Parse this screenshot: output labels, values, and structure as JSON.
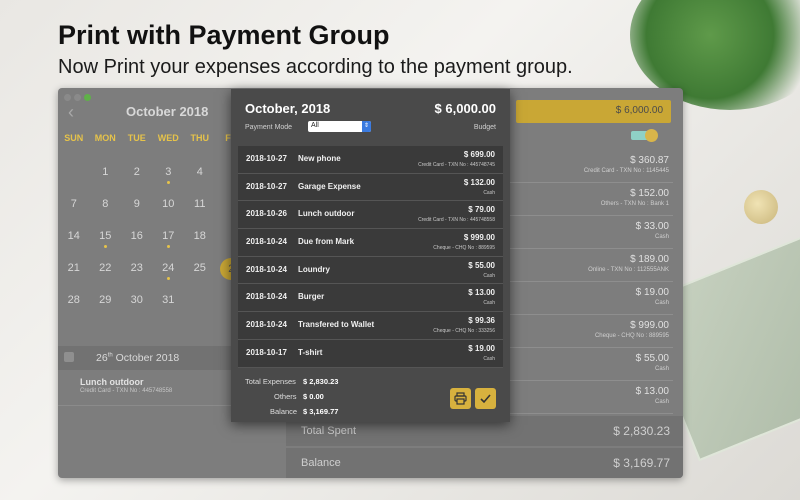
{
  "headline": "Print with Payment Group",
  "subline": "Now Print your expenses according to the payment group.",
  "calendar": {
    "back": "‹",
    "title": "October 2018",
    "days": [
      "SUN",
      "MON",
      "TUE",
      "WED",
      "THU",
      "FR"
    ],
    "rows": [
      [
        "",
        "1",
        "2",
        "3",
        "4",
        ""
      ],
      [
        "7",
        "8",
        "9",
        "10",
        "11",
        ""
      ],
      [
        "14",
        "15",
        "16",
        "17",
        "18",
        ""
      ],
      [
        "21",
        "22",
        "23",
        "24",
        "25",
        "2"
      ],
      [
        "28",
        "29",
        "30",
        "31",
        "",
        ""
      ]
    ]
  },
  "selected_date": {
    "day": "26",
    "suffix": "th",
    "rest": "October 2018"
  },
  "day_item": {
    "title": "Lunch outdoor",
    "sub": "Credit Card - TXN No : 445748558"
  },
  "budget_amount": "$ 6,000.00",
  "expenses": [
    {
      "amount": "$ 360.87",
      "sub": "Credit Card - TXN No : 1145445"
    },
    {
      "amount": "$ 152.00",
      "sub": "Others - TXN No : Bank 1"
    },
    {
      "amount": "$ 33.00",
      "sub": "Cash"
    },
    {
      "amount": "$ 189.00",
      "sub": "Online - TXN No : 112555ANK"
    },
    {
      "amount": "$ 19.00",
      "sub": "Cash"
    },
    {
      "amount": "$ 999.00",
      "sub": "Cheque - CHQ No : 889595"
    },
    {
      "amount": "$ 55.00",
      "sub": "Cash"
    },
    {
      "amount": "$ 13.00",
      "sub": "Cash"
    }
  ],
  "summary": {
    "total_spent_label": "Total Spent",
    "total_spent": "$ 2,830.23",
    "balance_label": "Balance",
    "balance": "$ 3,169.77"
  },
  "popup": {
    "month": "October, 2018",
    "total": "$ 6,000.00",
    "mode_label": "Payment Mode",
    "mode_value": "All",
    "budget_label": "Budget",
    "rows": [
      {
        "date": "2018-10-27",
        "name": "New phone",
        "amount": "$ 699.00",
        "meta": "Credit Card - TXN No : 445748745"
      },
      {
        "date": "2018-10-27",
        "name": "Garage Expense",
        "amount": "$ 132.00",
        "meta": "Cash"
      },
      {
        "date": "2018-10-26",
        "name": "Lunch outdoor",
        "amount": "$ 79.00",
        "meta": "Credit Card - TXN No : 445748558"
      },
      {
        "date": "2018-10-24",
        "name": "Due from Mark",
        "amount": "$ 999.00",
        "meta": "Cheque - CHQ No : 889595"
      },
      {
        "date": "2018-10-24",
        "name": "Loundry",
        "amount": "$ 55.00",
        "meta": "Cash"
      },
      {
        "date": "2018-10-24",
        "name": "Burger",
        "amount": "$ 13.00",
        "meta": "Cash"
      },
      {
        "date": "2018-10-24",
        "name": "Transfered to Wallet",
        "amount": "$ 99.36",
        "meta": "Cheque - CHQ No : 333256"
      },
      {
        "date": "2018-10-17",
        "name": "T-shirt",
        "amount": "$ 19.00",
        "meta": "Cash"
      }
    ],
    "total_expenses_label": "Total Expenses",
    "total_expenses": "$ 2,830.23",
    "others_label": "Others",
    "others": "$ 0.00",
    "balance_label": "Balance",
    "balance": "$ 3,169.77"
  }
}
